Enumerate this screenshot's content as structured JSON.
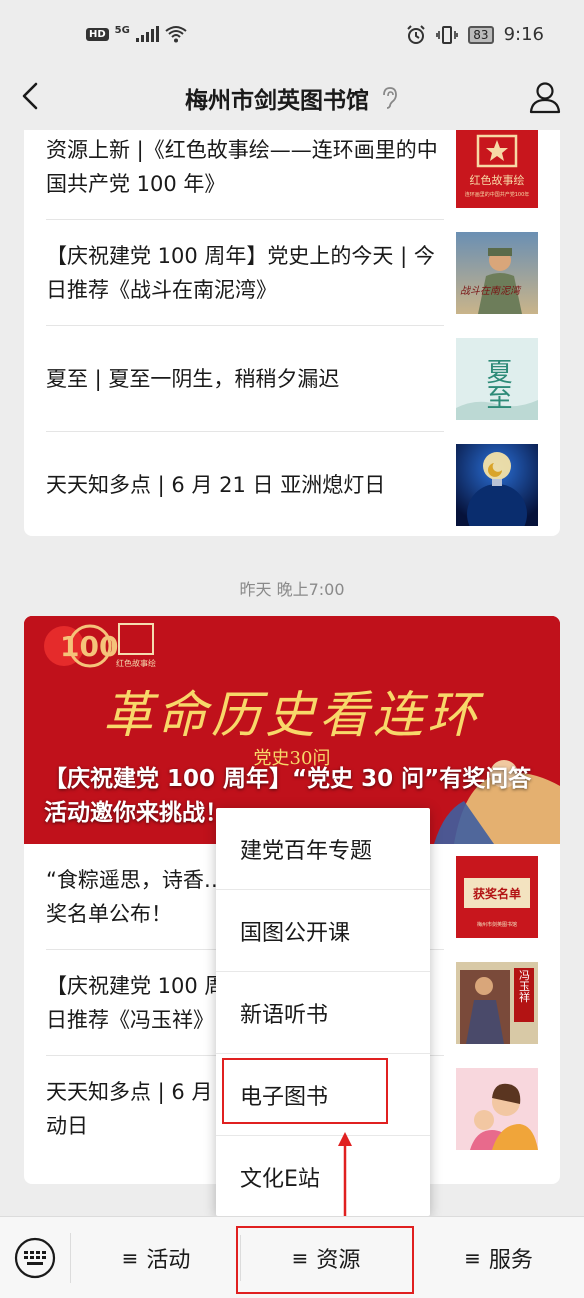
{
  "status_bar": {
    "hd": "HD",
    "network": "5G",
    "battery": "83",
    "time": "9:16"
  },
  "header": {
    "title": "梅州市剑英图书馆"
  },
  "feed_top": [
    {
      "text": "资源上新 |《红色故事绘——连环画里的中国共产党 100 年》",
      "thumb": "红色故事绘"
    },
    {
      "text": "【庆祝建党 100 周年】党史上的今天 | 今日推荐《战斗在南泥湾》",
      "thumb": "战斗在南泥湾"
    },
    {
      "text": "夏至 | 夏至一阴生，稍稍夕漏迟",
      "thumb": "夏至"
    },
    {
      "text": "天天知多点 | 6 月 21 日 亚洲熄灯日",
      "thumb": "lightbulb"
    }
  ],
  "timestamp": "昨天 晚上7:00",
  "banner": {
    "headline": "【庆祝建党 100 周年】“党史 30 问”有奖问答活动邀你来挑战！",
    "art_text": "革命历史看连环",
    "sub_art_text": "党史30问",
    "logo_text": "红色故事绘"
  },
  "feed_bottom": [
    {
      "text": "“食粽遥思，诗香…",
      "text2": "奖名单公布！",
      "thumb": "获奖名单"
    },
    {
      "text": "【庆祝建党 100 周",
      "text2": "日推荐《冯玉祥》",
      "thumb": "冯玉祥"
    },
    {
      "text": "天天知多点 | 6 月",
      "text2": "动日",
      "thumb": "family"
    }
  ],
  "menu": {
    "items": [
      "建党百年专题",
      "国图公开课",
      "新语听书",
      "电子图书",
      "文化E站"
    ],
    "highlighted": "电子图书"
  },
  "bottom_tabs": [
    {
      "icon": "≡",
      "label": "活动"
    },
    {
      "icon": "≡",
      "label": "资源"
    },
    {
      "icon": "≡",
      "label": "服务"
    }
  ],
  "colors": {
    "accent_red": "#e02020",
    "banner_red": "#c6101a"
  }
}
